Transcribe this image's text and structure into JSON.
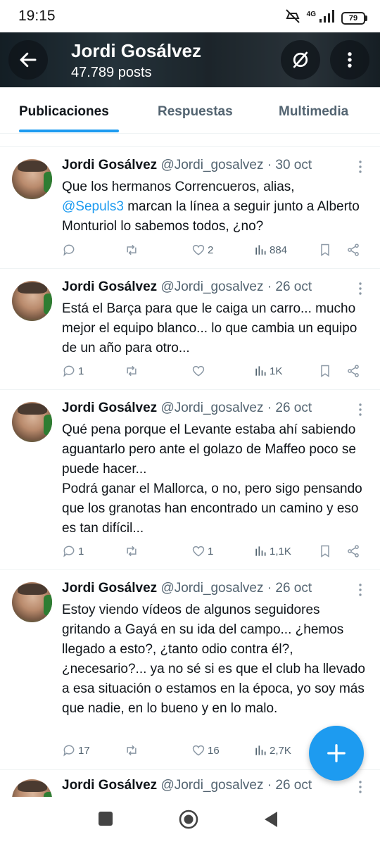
{
  "status_bar": {
    "time": "19:15",
    "network": "4G",
    "battery": "79",
    "icons": [
      "mute-icon",
      "signal-icon",
      "battery-icon"
    ]
  },
  "profile": {
    "name": "Jordi Gosálvez",
    "posts": "47.789 posts"
  },
  "tabs": [
    {
      "label": "Publicaciones",
      "active": true
    },
    {
      "label": "Respuestas",
      "active": false
    },
    {
      "label": "Multimedia",
      "active": false
    }
  ],
  "tweets": [
    {
      "name": "Jordi Gosálvez",
      "handle": "@Jordi_gosalvez",
      "sep": "·",
      "date": "30 oct",
      "text_before": "Que los hermanos Correncueros, alias,",
      "mention": "@Sepuls3",
      "text_after": " marcan la línea a seguir junto a Alberto Monturiol lo sabemos todos, ¿no?",
      "replies": "",
      "retweets": "",
      "likes": "2",
      "views": "884"
    },
    {
      "name": "Jordi Gosálvez",
      "handle": "@Jordi_gosalvez",
      "sep": "·",
      "date": "26 oct",
      "text": "Está el Barça para que le caiga un carro... mucho mejor el equipo blanco... lo que cambia un equipo de un año para otro...",
      "replies": "1",
      "retweets": "",
      "likes": "",
      "views": "1K"
    },
    {
      "name": "Jordi Gosálvez",
      "handle": "@Jordi_gosalvez",
      "sep": "·",
      "date": "26 oct",
      "text": "Qué pena porque el Levante estaba ahí sabiendo aguantarlo pero ante el golazo de Maffeo poco se puede hacer...",
      "text2": "Podrá ganar el Mallorca, o no, pero sigo pensando que los granotas han encontrado un camino y eso es tan difícil...",
      "replies": "1",
      "retweets": "",
      "likes": "1",
      "views": "1,1K"
    },
    {
      "name": "Jordi Gosálvez",
      "handle": "@Jordi_gosalvez",
      "sep": "·",
      "date": "26 oct",
      "text": "Estoy viendo vídeos de algunos seguidores gritando a Gayá en su ida del campo... ¿hemos llegado a esto?, ¿tanto odio contra él?, ¿necesario?... ya no sé si es que el club ha llevado a esa situación o estamos en la época, yo soy más que nadie, en lo bueno y en lo malo.",
      "replies": "17",
      "retweets": "",
      "likes": "16",
      "views": "2,7K"
    },
    {
      "name": "Jordi Gosálvez",
      "handle": "@Jordi_gosalvez",
      "sep": "·",
      "date": "26 oct"
    }
  ],
  "colors": {
    "accent": "#1d9bf0",
    "text_primary": "#0f1419",
    "text_secondary": "#536471"
  }
}
